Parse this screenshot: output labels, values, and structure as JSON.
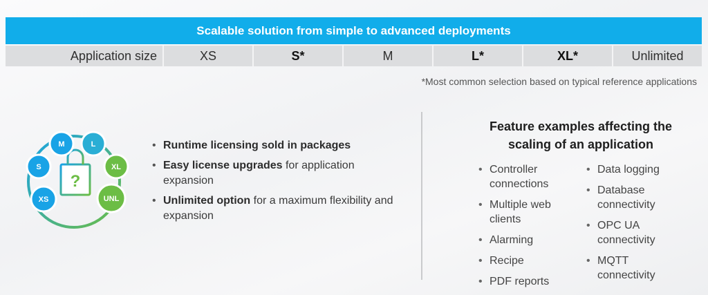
{
  "banner": {
    "title": "Scalable solution from simple to advanced deployments"
  },
  "size_table": {
    "label": "Application size",
    "sizes": [
      "XS",
      "S*",
      "M",
      "L*",
      "XL*",
      "Unlimited"
    ]
  },
  "footnote": "*Most common selection based on typical reference applications",
  "graphic": {
    "badges": [
      "M",
      "L",
      "S",
      "XL",
      "XS",
      "UNL"
    ],
    "bag_symbol": "?"
  },
  "licensing": {
    "items": [
      {
        "bold": "Runtime licensing sold in packages",
        "rest": ""
      },
      {
        "bold": "Easy license upgrades",
        "rest": " for application expansion"
      },
      {
        "bold": "Unlimited option",
        "rest": " for a maximum flexibility and expansion"
      }
    ]
  },
  "features": {
    "title": "Feature examples affecting the scaling of an application",
    "left": [
      "Controller connections",
      "Multiple web clients",
      "Alarming",
      "Recipe",
      "PDF reports"
    ],
    "right": [
      "Data logging",
      "Database connectivity",
      "OPC UA connectivity",
      "MQTT connectivity"
    ]
  },
  "colors": {
    "banner": "#11adea",
    "blue_badge": "#19a3e6",
    "green_badge": "#6cbd45"
  }
}
